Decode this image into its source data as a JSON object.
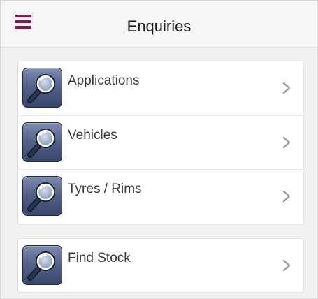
{
  "header": {
    "title": "Enquiries",
    "menu_icon": "hamburger-menu-icon"
  },
  "colors": {
    "accent": "#8a1848",
    "icon_background": "#55638a",
    "chevron": "#9a9a9a"
  },
  "groups": [
    {
      "items": [
        {
          "label": "Applications",
          "icon": "magnifier-icon"
        },
        {
          "label": "Vehicles",
          "icon": "magnifier-icon"
        },
        {
          "label": "Tyres / Rims",
          "icon": "magnifier-icon"
        }
      ]
    },
    {
      "items": [
        {
          "label": "Find Stock",
          "icon": "magnifier-icon"
        }
      ]
    }
  ]
}
